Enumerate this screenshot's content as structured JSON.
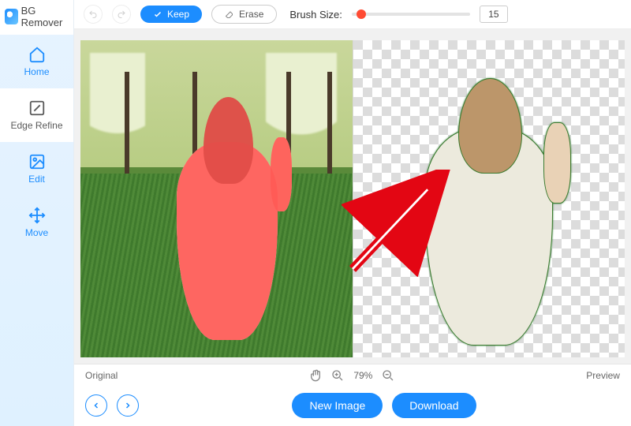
{
  "app_title": "BG Remover",
  "sidebar": {
    "items": [
      {
        "label": "Home"
      },
      {
        "label": "Edge Refine"
      },
      {
        "label": "Edit"
      },
      {
        "label": "Move"
      }
    ]
  },
  "toolbar": {
    "keep_label": "Keep",
    "erase_label": "Erase",
    "brush_label": "Brush Size:",
    "brush_value": "15"
  },
  "status": {
    "left_label": "Original",
    "zoom_value": "79%",
    "right_label": "Preview"
  },
  "footer": {
    "new_image_label": "New Image",
    "download_label": "Download"
  }
}
